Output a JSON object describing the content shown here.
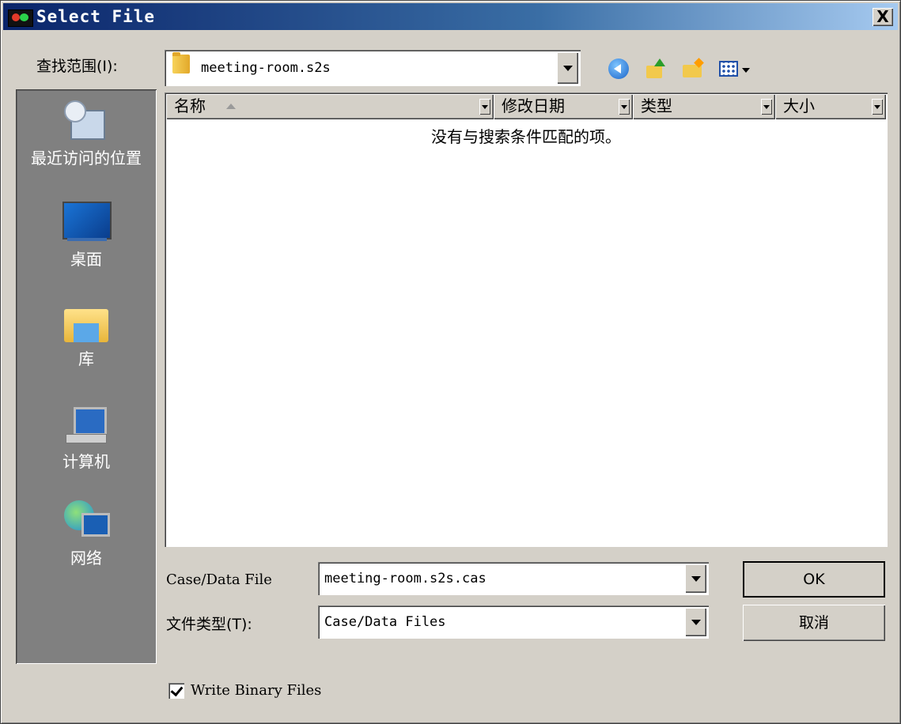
{
  "window": {
    "title": "Select File",
    "close_symbol": "X"
  },
  "toolbar": {
    "look_in_label": "查找范围(I):",
    "look_in_value": "meeting-room.s2s"
  },
  "places": [
    {
      "label": "最近访问的位置",
      "icon": "recent-places-icon"
    },
    {
      "label": "桌面",
      "icon": "desktop-icon"
    },
    {
      "label": "库",
      "icon": "libraries-icon"
    },
    {
      "label": "计算机",
      "icon": "computer-icon"
    },
    {
      "label": "网络",
      "icon": "network-icon"
    }
  ],
  "filelist": {
    "columns": [
      "名称",
      "修改日期",
      "类型",
      "大小"
    ],
    "empty_message": "没有与搜索条件匹配的项。"
  },
  "form": {
    "file_label": "Case/Data File",
    "file_value": "meeting-room.s2s.cas",
    "type_label": "文件类型(T):",
    "type_value": "Case/Data Files"
  },
  "buttons": {
    "ok": "OK",
    "cancel": "取消"
  },
  "options": {
    "write_binary_label": "Write Binary Files",
    "write_binary_checked": true
  }
}
